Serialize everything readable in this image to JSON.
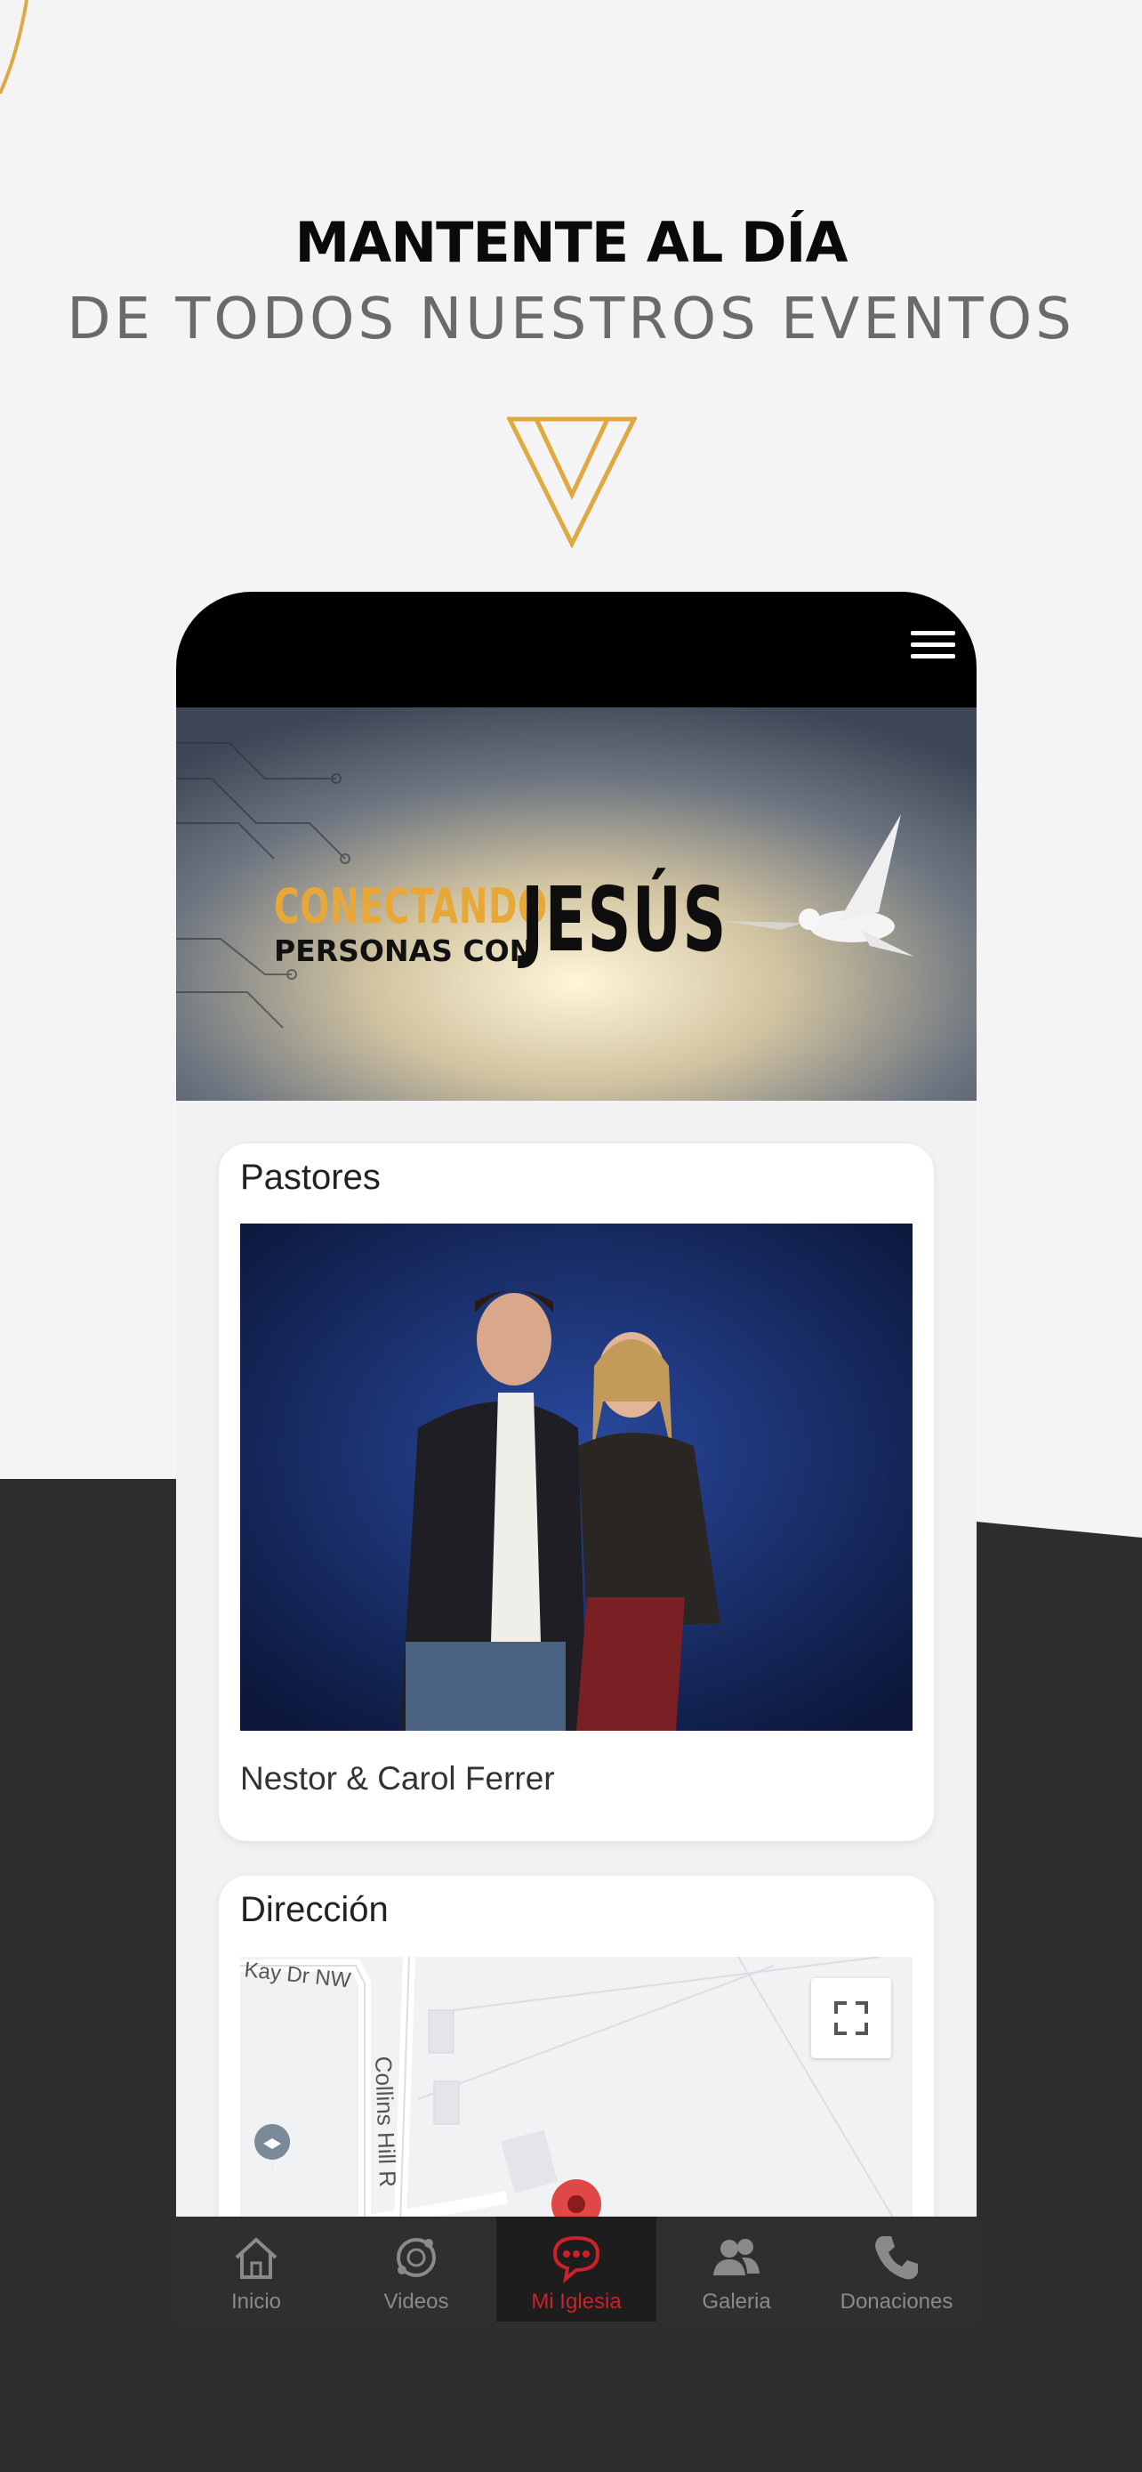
{
  "hero": {
    "headline": "MANTENTE AL DÍA",
    "subline": "DE TODOS NUESTROS EVENTOS"
  },
  "banner": {
    "line1": "CONECTANDO",
    "line2": "PERSONAS CON",
    "line3": "JESÚS"
  },
  "pastores": {
    "title": "Pastores",
    "names": "Nestor & Carol Ferrer"
  },
  "direccion": {
    "title": "Dirección",
    "map_street_1": "Kay Dr NW",
    "map_street_2": "Collins Hill R"
  },
  "tabs": [
    {
      "label": "Inicio",
      "icon": "home-icon"
    },
    {
      "label": "Videos",
      "icon": "videos-icon"
    },
    {
      "label": "Mi Iglesia",
      "icon": "chat-icon"
    },
    {
      "label": "Galeria",
      "icon": "people-icon"
    },
    {
      "label": "Donaciones",
      "icon": "phone-icon"
    }
  ],
  "colors": {
    "accent_gold": "#e8a838",
    "active_red": "#cc2129",
    "dark_bg": "#2e2e2e"
  }
}
